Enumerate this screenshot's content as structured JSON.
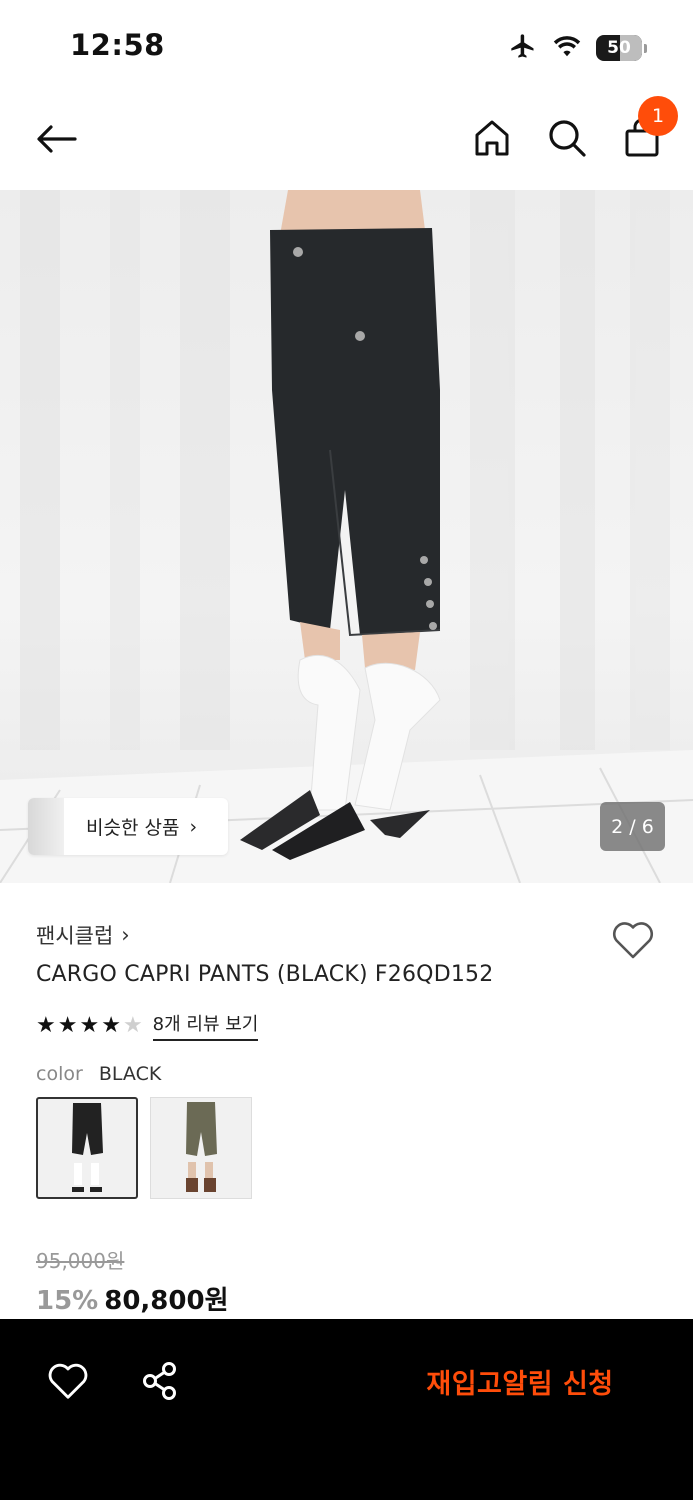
{
  "status_bar": {
    "time": "12:58",
    "battery_level": "50",
    "icons": [
      "airplane-icon",
      "wifi-icon",
      "battery-icon"
    ]
  },
  "nav": {
    "icons": [
      "back-arrow-icon",
      "home-icon",
      "search-icon",
      "shopping-bag-icon"
    ],
    "cart_count": "1",
    "badge_color": "#ff4d0a"
  },
  "gallery": {
    "similar_label": "비슷한 상품",
    "similar_chevron": "›",
    "page_indicator": "2 / 6"
  },
  "product": {
    "brand": "팬시클럽",
    "brand_chevron": "›",
    "title": "CARGO CAPRI PANTS (BLACK) F26QD152",
    "rating": 4,
    "rating_max": 5,
    "review_link": "8개 리뷰 보기",
    "color_label": "color",
    "color_value": "BLACK",
    "swatches": [
      "black-variant",
      "khaki-variant"
    ]
  },
  "price": {
    "original": "95,000원",
    "discount": "15%",
    "final": "80,800원"
  },
  "bottom_bar": {
    "icons": [
      "heart-icon",
      "share-icon"
    ],
    "restock_label": "재입고알림 신청",
    "accent_color": "#ff4d0a"
  }
}
